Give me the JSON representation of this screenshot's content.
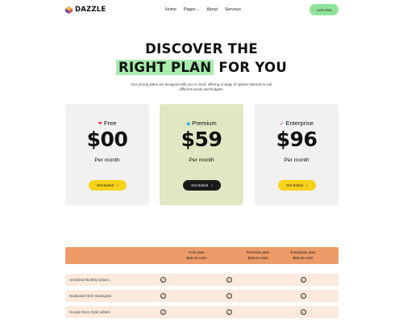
{
  "header": {
    "brand": "DAZZLE",
    "nav": [
      {
        "label": "Home",
        "dropdown": false
      },
      {
        "label": "Pages",
        "dropdown": true
      },
      {
        "label": "About",
        "dropdown": false
      },
      {
        "label": "Services",
        "dropdown": false
      }
    ],
    "cta_label": "Let's chat"
  },
  "hero": {
    "title_line1": "DISCOVER THE",
    "title_line2_highlight": "RIGHT PLAN",
    "title_line2_rest": "FOR YOU",
    "subtitle": "Our pricing plans are designed with you in mind, offering a range of options tailored to suit different needs and budgets."
  },
  "plans": [
    {
      "name": "Free",
      "icon": "heart-icon",
      "price": "$00",
      "period": "Per month",
      "button": "Get started"
    },
    {
      "name": "Premium",
      "icon": "diamond-icon",
      "price": "$59",
      "period": "Per month",
      "button": "Get started"
    },
    {
      "name": "Enterprise",
      "icon": "rocket-icon",
      "price": "$96",
      "period": "Per month",
      "button": "Get started"
    }
  ],
  "comparison": {
    "headers": [
      {
        "plan": "Free plan",
        "price": "$00.00 USD"
      },
      {
        "plan": "Premium plan",
        "price": "$59.00 USD"
      },
      {
        "plan": "Enterprise plan",
        "price": "$96.00 USD"
      }
    ],
    "rows": [
      {
        "label": "Unlimited Monthly visitors",
        "free": true,
        "premium": true,
        "enterprise": true
      },
      {
        "label": "Dedicated SEO Strategists",
        "free": true,
        "premium": true,
        "enterprise": true
      },
      {
        "label": "Google Docs Style editors",
        "free": true,
        "premium": true,
        "enterprise": true
      }
    ]
  },
  "colors": {
    "accent_green": "#8fe39b",
    "highlight_green": "#a8ecae",
    "card_grey": "#f1f1f1",
    "card_premium": "#dfe8c3",
    "button_yellow": "#f7d21a",
    "button_dark": "#1a1a1a",
    "table_header": "#ee9b6a",
    "table_row": "#fbe9dc"
  }
}
